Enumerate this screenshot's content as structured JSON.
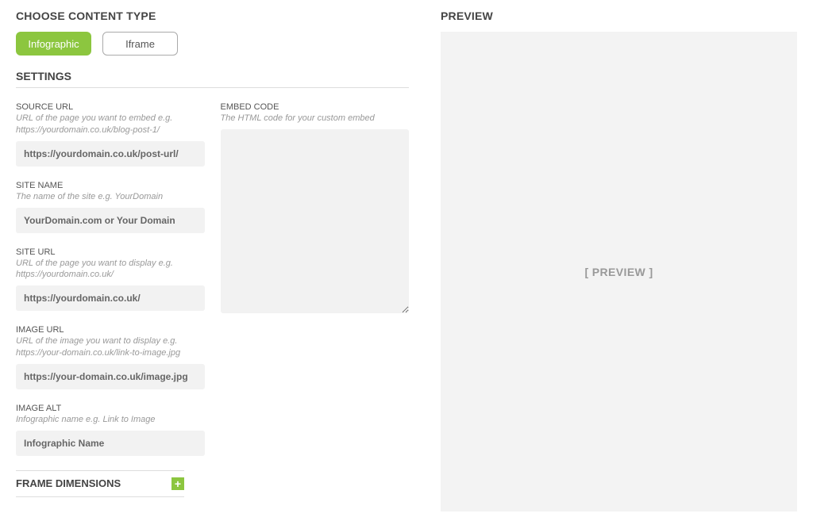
{
  "header": {
    "choose_type_title": "CHOOSE CONTENT TYPE"
  },
  "tabs": {
    "infographic": "Infographic",
    "iframe": "Iframe"
  },
  "settings": {
    "title": "SETTINGS",
    "source_url": {
      "label": "SOURCE URL",
      "help": "URL of the page you want to embed e.g. https://yourdomain.co.uk/blog-post-1/",
      "placeholder": "https://yourdomain.co.uk/post-url/"
    },
    "site_name": {
      "label": "SITE NAME",
      "help": "The name of the site e.g. YourDomain",
      "placeholder": "YourDomain.com or Your Domain"
    },
    "site_url": {
      "label": "SITE URL",
      "help": "URL of the page you want to display e.g. https://yourdomain.co.uk/",
      "placeholder": "https://yourdomain.co.uk/"
    },
    "image_url": {
      "label": "IMAGE URL",
      "help": "URL of the image you want to display e.g. https://your-domain.co.uk/link-to-image.jpg",
      "placeholder": "https://your-domain.co.uk/image.jpg"
    },
    "image_alt": {
      "label": "IMAGE ALT",
      "help": "Infographic name e.g. Link to Image",
      "placeholder": "Infographic Name"
    },
    "embed_code": {
      "label": "EMBED CODE",
      "help": "The HTML code for your custom embed"
    }
  },
  "frame_dimensions": {
    "title": "FRAME DIMENSIONS"
  },
  "preview": {
    "title": "PREVIEW",
    "placeholder": "[ PREVIEW ]"
  }
}
